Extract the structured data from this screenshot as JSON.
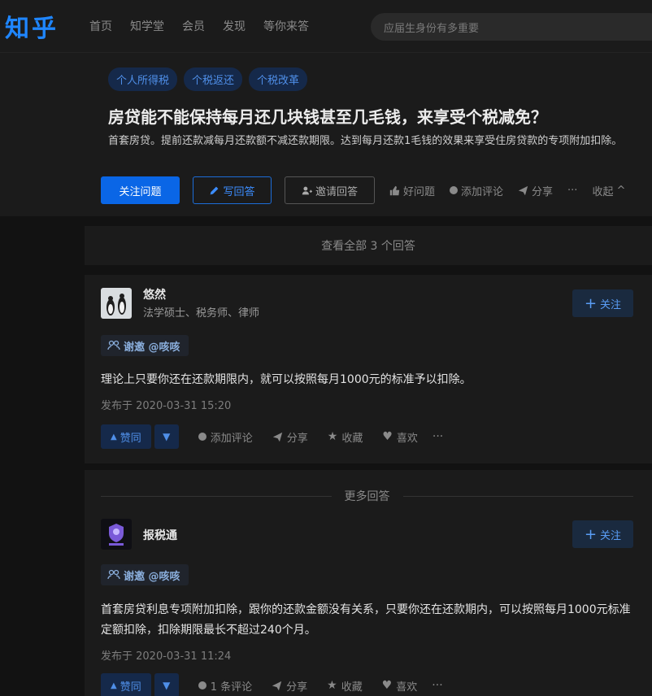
{
  "nav": {
    "logo": "知乎",
    "items": [
      "首页",
      "知学堂",
      "会员",
      "发现",
      "等你来答"
    ],
    "search_placeholder": "应届生身份有多重要"
  },
  "question": {
    "tags": [
      "个人所得税",
      "个税返还",
      "个税改革"
    ],
    "title": "房贷能不能保持每月还几块钱甚至几毛钱，来享受个税减免？",
    "description": "首套房贷。提前还款减每月还款额不减还款期限。达到每月还款1毛钱的效果来享受住房贷款的专项附加扣除。",
    "actions": {
      "follow": "关注问题",
      "write": "写回答",
      "invite": "邀请回答",
      "good": "好问题",
      "comment": "添加评论",
      "share": "分享",
      "more": "···",
      "collapse": "收起"
    }
  },
  "view_all": "查看全部 3 个回答",
  "more_answers": "更多回答",
  "answers": [
    {
      "author": "悠然",
      "headline": "法学硕士、税务师、律师",
      "follow": "关注",
      "thanks": "谢邀 @咳咳",
      "content": "理论上只要你还在还款期限内，就可以按照每月1000元的标准予以扣除。",
      "time": "发布于 2020-03-31 15:20",
      "vote": "赞同",
      "comment": "添加评论",
      "share": "分享",
      "collect": "收藏",
      "like": "喜欢",
      "more": "···"
    },
    {
      "author": "报税通",
      "headline": "",
      "follow": "关注",
      "thanks": "谢邀 @咳咳",
      "content": "首套房贷利息专项附加扣除，跟你的还款金额没有关系，只要你还在还款期内，可以按照每月1000元标准定额扣除，扣除期限最长不超过240个月。",
      "time": "发布于 2020-03-31 11:24",
      "vote": "赞同",
      "comment": "1 条评论",
      "share": "分享",
      "collect": "收藏",
      "like": "喜欢",
      "more": "···"
    }
  ],
  "colors": {
    "background": "#121212",
    "surface": "#1b1b1b",
    "brand": "#1f86ff",
    "primary_button": "#0a66e6"
  }
}
